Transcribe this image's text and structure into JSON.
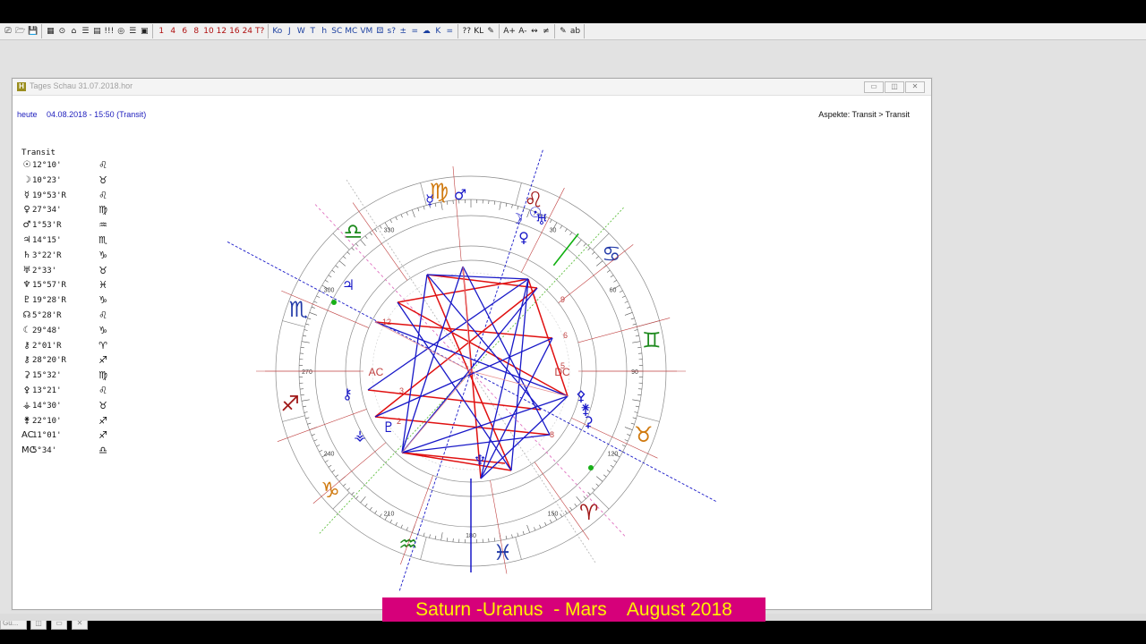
{
  "toolbar": {
    "groups": [
      [
        "⎚",
        "🗁",
        "💾"
      ],
      [
        "▦",
        "⊙",
        "⌂",
        "☰",
        "▤",
        "!!!",
        "◎",
        "☰",
        "▣"
      ],
      [
        "1",
        "4",
        "6",
        "8",
        "10",
        "12",
        "16",
        "24",
        "T?"
      ],
      [
        "Ko",
        "J",
        "W",
        "T",
        "h",
        "SC",
        "MC",
        "VM",
        "⚄",
        "s?",
        "±",
        "=",
        "☁",
        "K",
        "="
      ],
      [
        "??",
        "KL",
        "✎"
      ],
      [
        "A+",
        "A-",
        "↭",
        "≠"
      ],
      [
        "✎",
        "ab"
      ]
    ]
  },
  "window": {
    "title": "Tages Schau 31.07.2018.hor",
    "controls": [
      "▭",
      "◫",
      "✕"
    ]
  },
  "header": {
    "today_label": "heute",
    "datetime": "04.08.2018 - 15:50 (Transit)",
    "aspects": "Aspekte: Transit > Transit"
  },
  "planet_list": {
    "heading": "Transit",
    "rows": [
      {
        "glyph": "☉",
        "pos": "12°10'",
        "sign": "♌"
      },
      {
        "glyph": "☽",
        "pos": "10°23'",
        "sign": "♉"
      },
      {
        "glyph": "☿",
        "pos": "19°53'R",
        "sign": "♌"
      },
      {
        "glyph": "♀",
        "pos": "27°34'",
        "sign": "♍"
      },
      {
        "glyph": "♂",
        "pos": " 1°53'R",
        "sign": "♒"
      },
      {
        "glyph": "♃",
        "pos": "14°15'",
        "sign": "♏"
      },
      {
        "glyph": "♄",
        "pos": " 3°22'R",
        "sign": "♑"
      },
      {
        "glyph": "♅",
        "pos": " 2°33'",
        "sign": "♉"
      },
      {
        "glyph": "♆",
        "pos": "15°57'R",
        "sign": "♓"
      },
      {
        "glyph": "♇",
        "pos": "19°28'R",
        "sign": "♑"
      },
      {
        "glyph": "☊",
        "pos": " 5°28'R",
        "sign": "♌"
      },
      {
        "glyph": "☾",
        "pos": "29°48'",
        "sign": "♑"
      },
      {
        "glyph": "⚷",
        "pos": " 2°01'R",
        "sign": "♈"
      },
      {
        "glyph": "⚷",
        "pos": "28°20'R",
        "sign": "♐"
      },
      {
        "glyph": "⚳",
        "pos": "15°32'",
        "sign": "♍"
      },
      {
        "glyph": "⚴",
        "pos": "13°21'",
        "sign": "♌"
      },
      {
        "glyph": "⚶",
        "pos": "14°30'",
        "sign": "♉"
      },
      {
        "glyph": "⚵",
        "pos": "22°10'",
        "sign": "♐"
      },
      {
        "glyph": "AC",
        "pos": "11°01'",
        "sign": "♐"
      },
      {
        "glyph": "MC",
        "pos": " 5°34'",
        "sign": "♎"
      }
    ]
  },
  "chart": {
    "angle_labels": [
      "AC",
      "DC"
    ],
    "signs": [
      {
        "glyph": "♍",
        "color": "#d07a10"
      },
      {
        "glyph": "♌",
        "color": "#a01818"
      },
      {
        "glyph": "♋",
        "color": "#223aa8"
      },
      {
        "glyph": "♊",
        "color": "#1e8a1e"
      },
      {
        "glyph": "♉",
        "color": "#d07a10"
      },
      {
        "glyph": "♈",
        "color": "#a01818"
      },
      {
        "glyph": "♓",
        "color": "#223aa8"
      },
      {
        "glyph": "♒",
        "color": "#1e8a1e"
      },
      {
        "glyph": "♑",
        "color": "#d07a10"
      },
      {
        "glyph": "♐",
        "color": "#a01818"
      },
      {
        "glyph": "♏",
        "color": "#223aa8"
      },
      {
        "glyph": "♎",
        "color": "#1e8a1e"
      }
    ],
    "degree_labels": [
      "30",
      "60",
      "90",
      "120",
      "150",
      "180",
      "210",
      "240",
      "270",
      "300",
      "330"
    ],
    "house_numbers": [
      "6",
      "5",
      "2",
      "3",
      "12",
      "8",
      "9"
    ],
    "planet_glyphs": [
      "☉",
      "♀",
      "♅",
      "♃",
      "♆",
      "♇",
      "☿",
      "♂",
      "☽",
      "⚳",
      "⚴",
      "⚵",
      "⚷",
      "⚶"
    ],
    "colors": {
      "red": "#e01010",
      "blue": "#1818c8",
      "green": "#10b010",
      "ring": "#8a8a8a"
    }
  },
  "taskbar": {
    "items": [
      "Gu...",
      "◫",
      "▭",
      "✕"
    ]
  },
  "banner": {
    "text": "Saturn -Uranus  - Mars    August 2018"
  }
}
